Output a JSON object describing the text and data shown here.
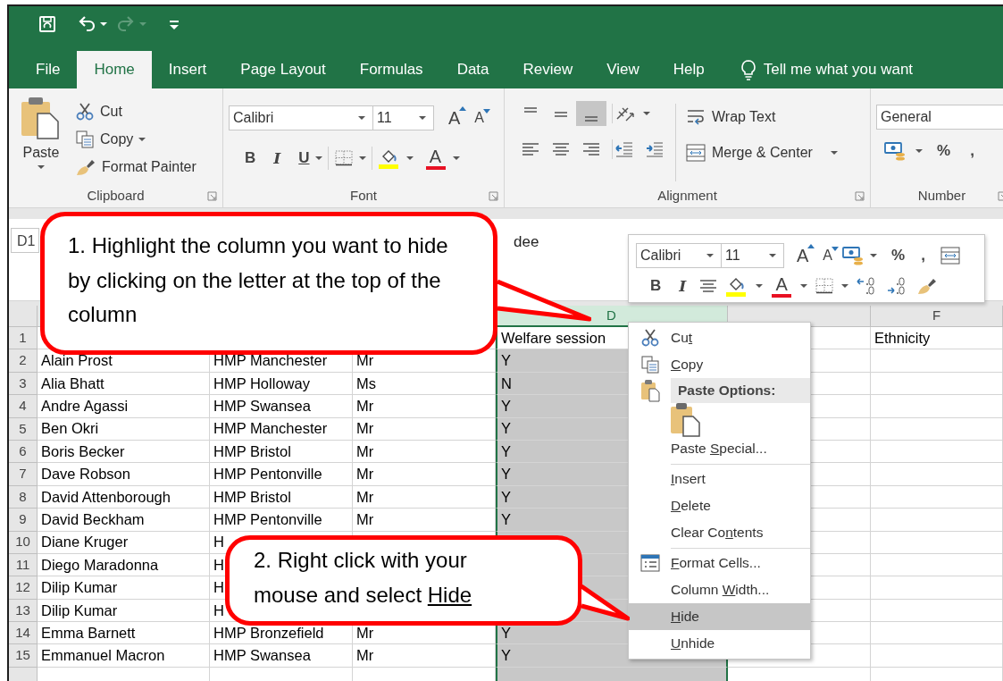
{
  "quick_access": [
    {
      "kind": "save",
      "disabled": false
    },
    {
      "kind": "undo",
      "disabled": false
    },
    {
      "kind": "redo",
      "disabled": true
    },
    {
      "kind": "customize",
      "disabled": false
    }
  ],
  "tabs": [
    {
      "label": "File",
      "selected": false
    },
    {
      "label": "Home",
      "selected": true
    },
    {
      "label": "Insert",
      "selected": false
    },
    {
      "label": "Page Layout",
      "selected": false
    },
    {
      "label": "Formulas",
      "selected": false
    },
    {
      "label": "Data",
      "selected": false
    },
    {
      "label": "Review",
      "selected": false
    },
    {
      "label": "View",
      "selected": false
    },
    {
      "label": "Help",
      "selected": false
    }
  ],
  "tell_me": "Tell me what you want",
  "clipboard": {
    "paste": "Paste",
    "cut": "Cut",
    "copy": "Copy",
    "format_painter": "Format Painter",
    "label": "Clipboard"
  },
  "font": {
    "name": "Calibri",
    "size": "11",
    "grow": "A",
    "shrink": "A",
    "bold": "B",
    "italic": "I",
    "underline": "U",
    "font_color": "A",
    "label": "Font"
  },
  "alignment": {
    "vertical": [
      {
        "kind": "top",
        "selected": false
      },
      {
        "kind": "middle",
        "selected": false
      },
      {
        "kind": "bottom",
        "selected": true
      }
    ],
    "horizontal": [
      {
        "kind": "left"
      },
      {
        "kind": "center"
      },
      {
        "kind": "right"
      }
    ],
    "wrap_text": "Wrap Text",
    "merge_center": "Merge & Center",
    "label": "Alignment"
  },
  "number": {
    "format": "General",
    "percent": "%",
    "comma": ",",
    "label": "Number"
  },
  "formula_bar": {
    "name_box": "D1",
    "content": "dee"
  },
  "mini_toolbar": {
    "font_name": "Calibri",
    "font_size": "11",
    "grow": "A",
    "shrink": "A",
    "percent": "%",
    "comma": ",",
    "bold": "B",
    "italic": "I",
    "font_color": "A"
  },
  "column_headers": [
    {
      "label": "D",
      "selected": true
    },
    {
      "selected": false
    },
    {
      "label": "F",
      "selected": false
    }
  ],
  "rows": [
    {
      "number": "1",
      "active": true,
      "cells": [
        null,
        null,
        null,
        "Welfare session",
        null,
        "Ethnicity"
      ]
    },
    {
      "number": "2",
      "active": false,
      "cells": [
        "Alain Prost",
        "HMP Manchester",
        "Mr",
        "Y",
        null,
        null
      ]
    },
    {
      "number": "3",
      "active": false,
      "cells": [
        "Alia Bhatt",
        "HMP Holloway",
        "Ms",
        "N",
        null,
        null
      ]
    },
    {
      "number": "4",
      "active": false,
      "cells": [
        "Andre Agassi",
        "HMP Swansea",
        "Mr",
        "Y",
        null,
        null
      ]
    },
    {
      "number": "5",
      "active": false,
      "cells": [
        "Ben Okri",
        "HMP Manchester",
        "Mr",
        "Y",
        null,
        null
      ]
    },
    {
      "number": "6",
      "active": false,
      "cells": [
        "Boris Becker",
        "HMP Bristol",
        "Mr",
        "Y",
        null,
        null
      ]
    },
    {
      "number": "7",
      "active": false,
      "cells": [
        "Dave Robson",
        "HMP Pentonville",
        "Mr",
        "Y",
        null,
        null
      ]
    },
    {
      "number": "8",
      "active": false,
      "cells": [
        "David Attenborough",
        "HMP Bristol",
        "Mr",
        "Y",
        null,
        null
      ]
    },
    {
      "number": "9",
      "active": false,
      "cells": [
        "David Beckham",
        "HMP Pentonville",
        "Mr",
        "Y",
        null,
        null
      ]
    },
    {
      "number": "10",
      "active": false,
      "cells": [
        "Diane Kruger",
        "H",
        null,
        null,
        null,
        null
      ]
    },
    {
      "number": "11",
      "active": false,
      "cells": [
        "Diego Maradonna",
        "H",
        null,
        null,
        null,
        null
      ]
    },
    {
      "number": "12",
      "active": false,
      "cells": [
        "Dilip Kumar",
        "H",
        null,
        null,
        null,
        null
      ]
    },
    {
      "number": "13",
      "active": false,
      "cells": [
        "Dilip Kumar",
        "H",
        null,
        null,
        null,
        null
      ]
    },
    {
      "number": "14",
      "active": false,
      "cells": [
        "Emma Barnett",
        "HMP Bronzefield",
        "Mr",
        "Y",
        null,
        null
      ]
    },
    {
      "number": "15",
      "active": false,
      "cells": [
        "Emmanuel Macron",
        "HMP Swansea",
        "Mr",
        "Y",
        null,
        null
      ]
    },
    {
      "active": false,
      "cells": [
        null,
        null,
        null,
        null,
        null,
        null
      ]
    }
  ],
  "context_menu": [
    {
      "kind": "item",
      "pre": "Cu",
      "key": "t",
      "selected": false
    },
    {
      "kind": "item",
      "key": "C",
      "post": "opy",
      "selected": false
    },
    {
      "kind": "header",
      "label": "Paste Options:"
    },
    {
      "kind": "paste-options"
    },
    {
      "kind": "item",
      "pre": "Paste ",
      "key": "S",
      "post": "pecial...",
      "selected": false
    },
    {
      "kind": "separator"
    },
    {
      "kind": "item",
      "key": "I",
      "post": "nsert",
      "selected": false
    },
    {
      "kind": "item",
      "key": "D",
      "post": "elete",
      "selected": false
    },
    {
      "kind": "item",
      "pre": "Clear Co",
      "key": "n",
      "post": "tents",
      "selected": false
    },
    {
      "kind": "separator"
    },
    {
      "kind": "item",
      "key": "F",
      "post": "ormat Cells...",
      "selected": false
    },
    {
      "kind": "item",
      "pre": "Column ",
      "key": "W",
      "post": "idth...",
      "selected": false
    },
    {
      "kind": "item",
      "key": "H",
      "post": "ide",
      "selected": true
    },
    {
      "kind": "item",
      "key": "U",
      "post": "nhide",
      "selected": false
    }
  ],
  "callouts": [
    {
      "number": "1.",
      "text": "Highlight the column you want to hide by clicking on the letter at the top of the column"
    },
    {
      "number": "2.",
      "text": "Right click with your mouse and select ",
      "key": "Hide"
    }
  ]
}
